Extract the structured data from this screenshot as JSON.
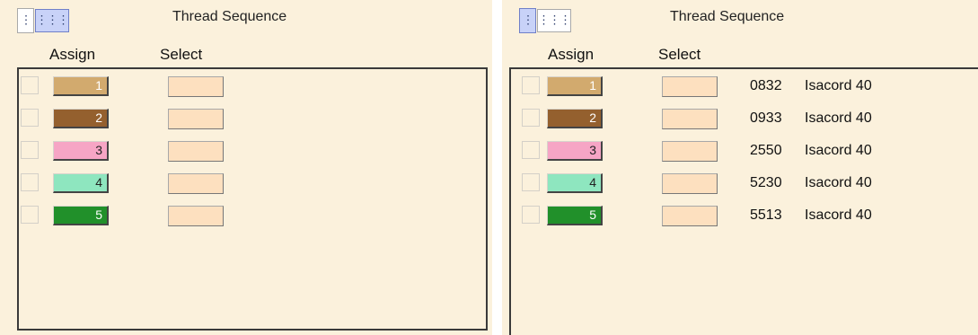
{
  "panels": [
    {
      "title": "Thread Sequence",
      "columns": {
        "assign": "Assign",
        "select": "Select"
      },
      "rows": [
        {
          "number": "1",
          "color": "#d2aa6e",
          "text_color": "#ffffff"
        },
        {
          "number": "2",
          "color": "#94602e",
          "text_color": "#ffffff"
        },
        {
          "number": "3",
          "color": "#f6a5c5",
          "text_color": "#222222"
        },
        {
          "number": "4",
          "color": "#8ee6bf",
          "text_color": "#222222"
        },
        {
          "number": "5",
          "color": "#21902a",
          "text_color": "#ffffff"
        }
      ]
    },
    {
      "title": "Thread Sequence",
      "columns": {
        "assign": "Assign",
        "select": "Select"
      },
      "rows": [
        {
          "number": "1",
          "color": "#d2aa6e",
          "text_color": "#ffffff",
          "code": "0832",
          "name": "Isacord 40"
        },
        {
          "number": "2",
          "color": "#94602e",
          "text_color": "#ffffff",
          "code": "0933",
          "name": "Isacord 40"
        },
        {
          "number": "3",
          "color": "#f6a5c5",
          "text_color": "#222222",
          "code": "2550",
          "name": "Isacord 40"
        },
        {
          "number": "4",
          "color": "#8ee6bf",
          "text_color": "#222222",
          "code": "5230",
          "name": "Isacord 40"
        },
        {
          "number": "5",
          "color": "#21902a",
          "text_color": "#ffffff",
          "code": "5513",
          "name": "Isacord 40"
        }
      ]
    }
  ],
  "icons": {
    "list_view": "list-view-icon",
    "grid_view": "grid-view-icon"
  }
}
